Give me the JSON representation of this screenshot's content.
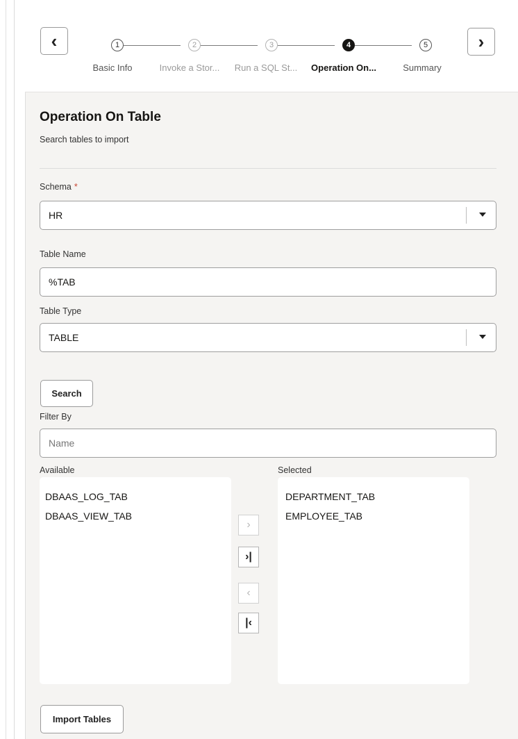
{
  "train": {
    "prev_icon": "chevron-left-icon",
    "next_icon": "chevron-right-icon",
    "steps": [
      {
        "number": "1",
        "label": "Basic Info",
        "state": "visited"
      },
      {
        "number": "2",
        "label": "Invoke a Stor...",
        "state": "unvisited"
      },
      {
        "number": "3",
        "label": "Run a SQL St...",
        "state": "unvisited"
      },
      {
        "number": "4",
        "label": "Operation On...",
        "state": "current"
      },
      {
        "number": "5",
        "label": "Summary",
        "state": "visited"
      }
    ]
  },
  "page": {
    "title": "Operation On Table",
    "subtitle": "Search tables to import"
  },
  "form": {
    "schema": {
      "label": "Schema",
      "required_mark": "*",
      "value": "HR"
    },
    "table_name": {
      "label": "Table Name",
      "value": "%TAB"
    },
    "table_type": {
      "label": "Table Type",
      "value": "TABLE"
    },
    "search_label": "Search",
    "filter": {
      "label": "Filter By",
      "placeholder": "Name",
      "value": ""
    }
  },
  "shuttle": {
    "available_label": "Available",
    "selected_label": "Selected",
    "available": [
      "DBAAS_LOG_TAB",
      "DBAAS_VIEW_TAB"
    ],
    "selected": [
      "DEPARTMENT_TAB",
      "EMPLOYEE_TAB"
    ],
    "buttons": {
      "move_right": "›",
      "move_all_right": "›|",
      "move_left": "‹",
      "move_all_left": "|‹"
    }
  },
  "import_label": "Import Tables",
  "colors": {
    "accent": "#161513",
    "required": "#c74634",
    "panel": "#f5f4f2"
  }
}
